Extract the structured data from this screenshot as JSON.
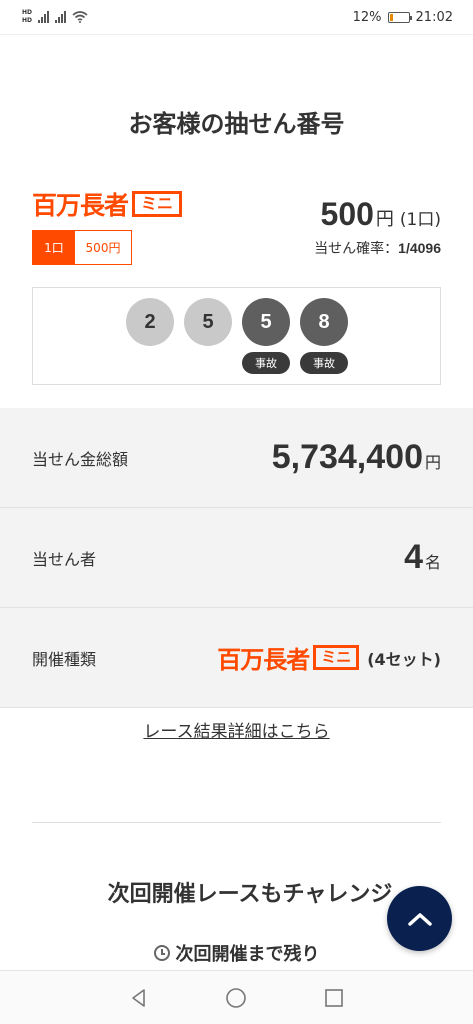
{
  "status_bar": {
    "hd1": "HD",
    "hd2": "HD",
    "battery_percent": "12%",
    "time": "21:02"
  },
  "page_title": "お客様の抽せん番号",
  "logo": {
    "main": "百万長者",
    "mini": "ミニ"
  },
  "ticket": {
    "unit_count": "1口",
    "unit_price": "500円",
    "price_value": "500",
    "price_yen": "円",
    "price_units": "(1口)",
    "probability_label": "当せん確率：",
    "probability_value": "1/4096"
  },
  "numbers": [
    {
      "value": "2",
      "style": "light",
      "tag": ""
    },
    {
      "value": "5",
      "style": "light",
      "tag": ""
    },
    {
      "value": "5",
      "style": "dark",
      "tag": "事故"
    },
    {
      "value": "8",
      "style": "dark",
      "tag": "事故"
    }
  ],
  "info": {
    "total_label": "当せん金総額",
    "total_value": "5,734,400",
    "total_unit": "円",
    "winners_label": "当せん者",
    "winners_value": "4",
    "winners_unit": "名",
    "type_label": "開催種類",
    "type_sets": "(4セット)"
  },
  "detail_link": "レース結果詳細はこちら",
  "next": {
    "title": "次回開催レースもチャレンジ",
    "remain": "次回開催まで残り"
  },
  "colors": {
    "brand_orange": "#ff4a00",
    "fab_navy": "#0a2150"
  }
}
